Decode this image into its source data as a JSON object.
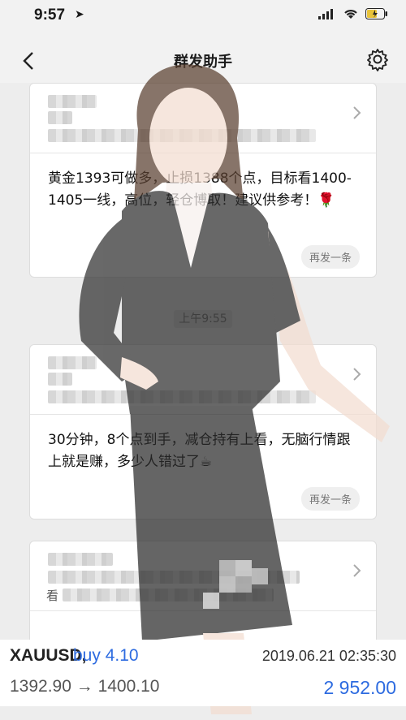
{
  "status_bar": {
    "time": "9:57"
  },
  "nav": {
    "title": "群发助手"
  },
  "cards": [
    {
      "message": "黄金1393可做多，止损1388个点，目标看1400-1405一线，高位，轻仓博取！建议供参考！🌹",
      "resend_label": "再发一条"
    },
    {
      "message": "30分钟，8个点到手，减仓持有上看，无脑行情跟上就是赚，多少人错过了☕",
      "resend_label": "再发一条"
    },
    {
      "message": "看"
    }
  ],
  "time_divider": "上午9:55",
  "trade": {
    "symbol": "XAUUSD,",
    "side": "buy 4.10",
    "datetime": "2019.06.21 02:35:30",
    "prices": "1392.90 → 1400.10",
    "profit": "2 952.00"
  },
  "colors": {
    "accent_blue": "#2d6be0",
    "background": "#ededed"
  }
}
